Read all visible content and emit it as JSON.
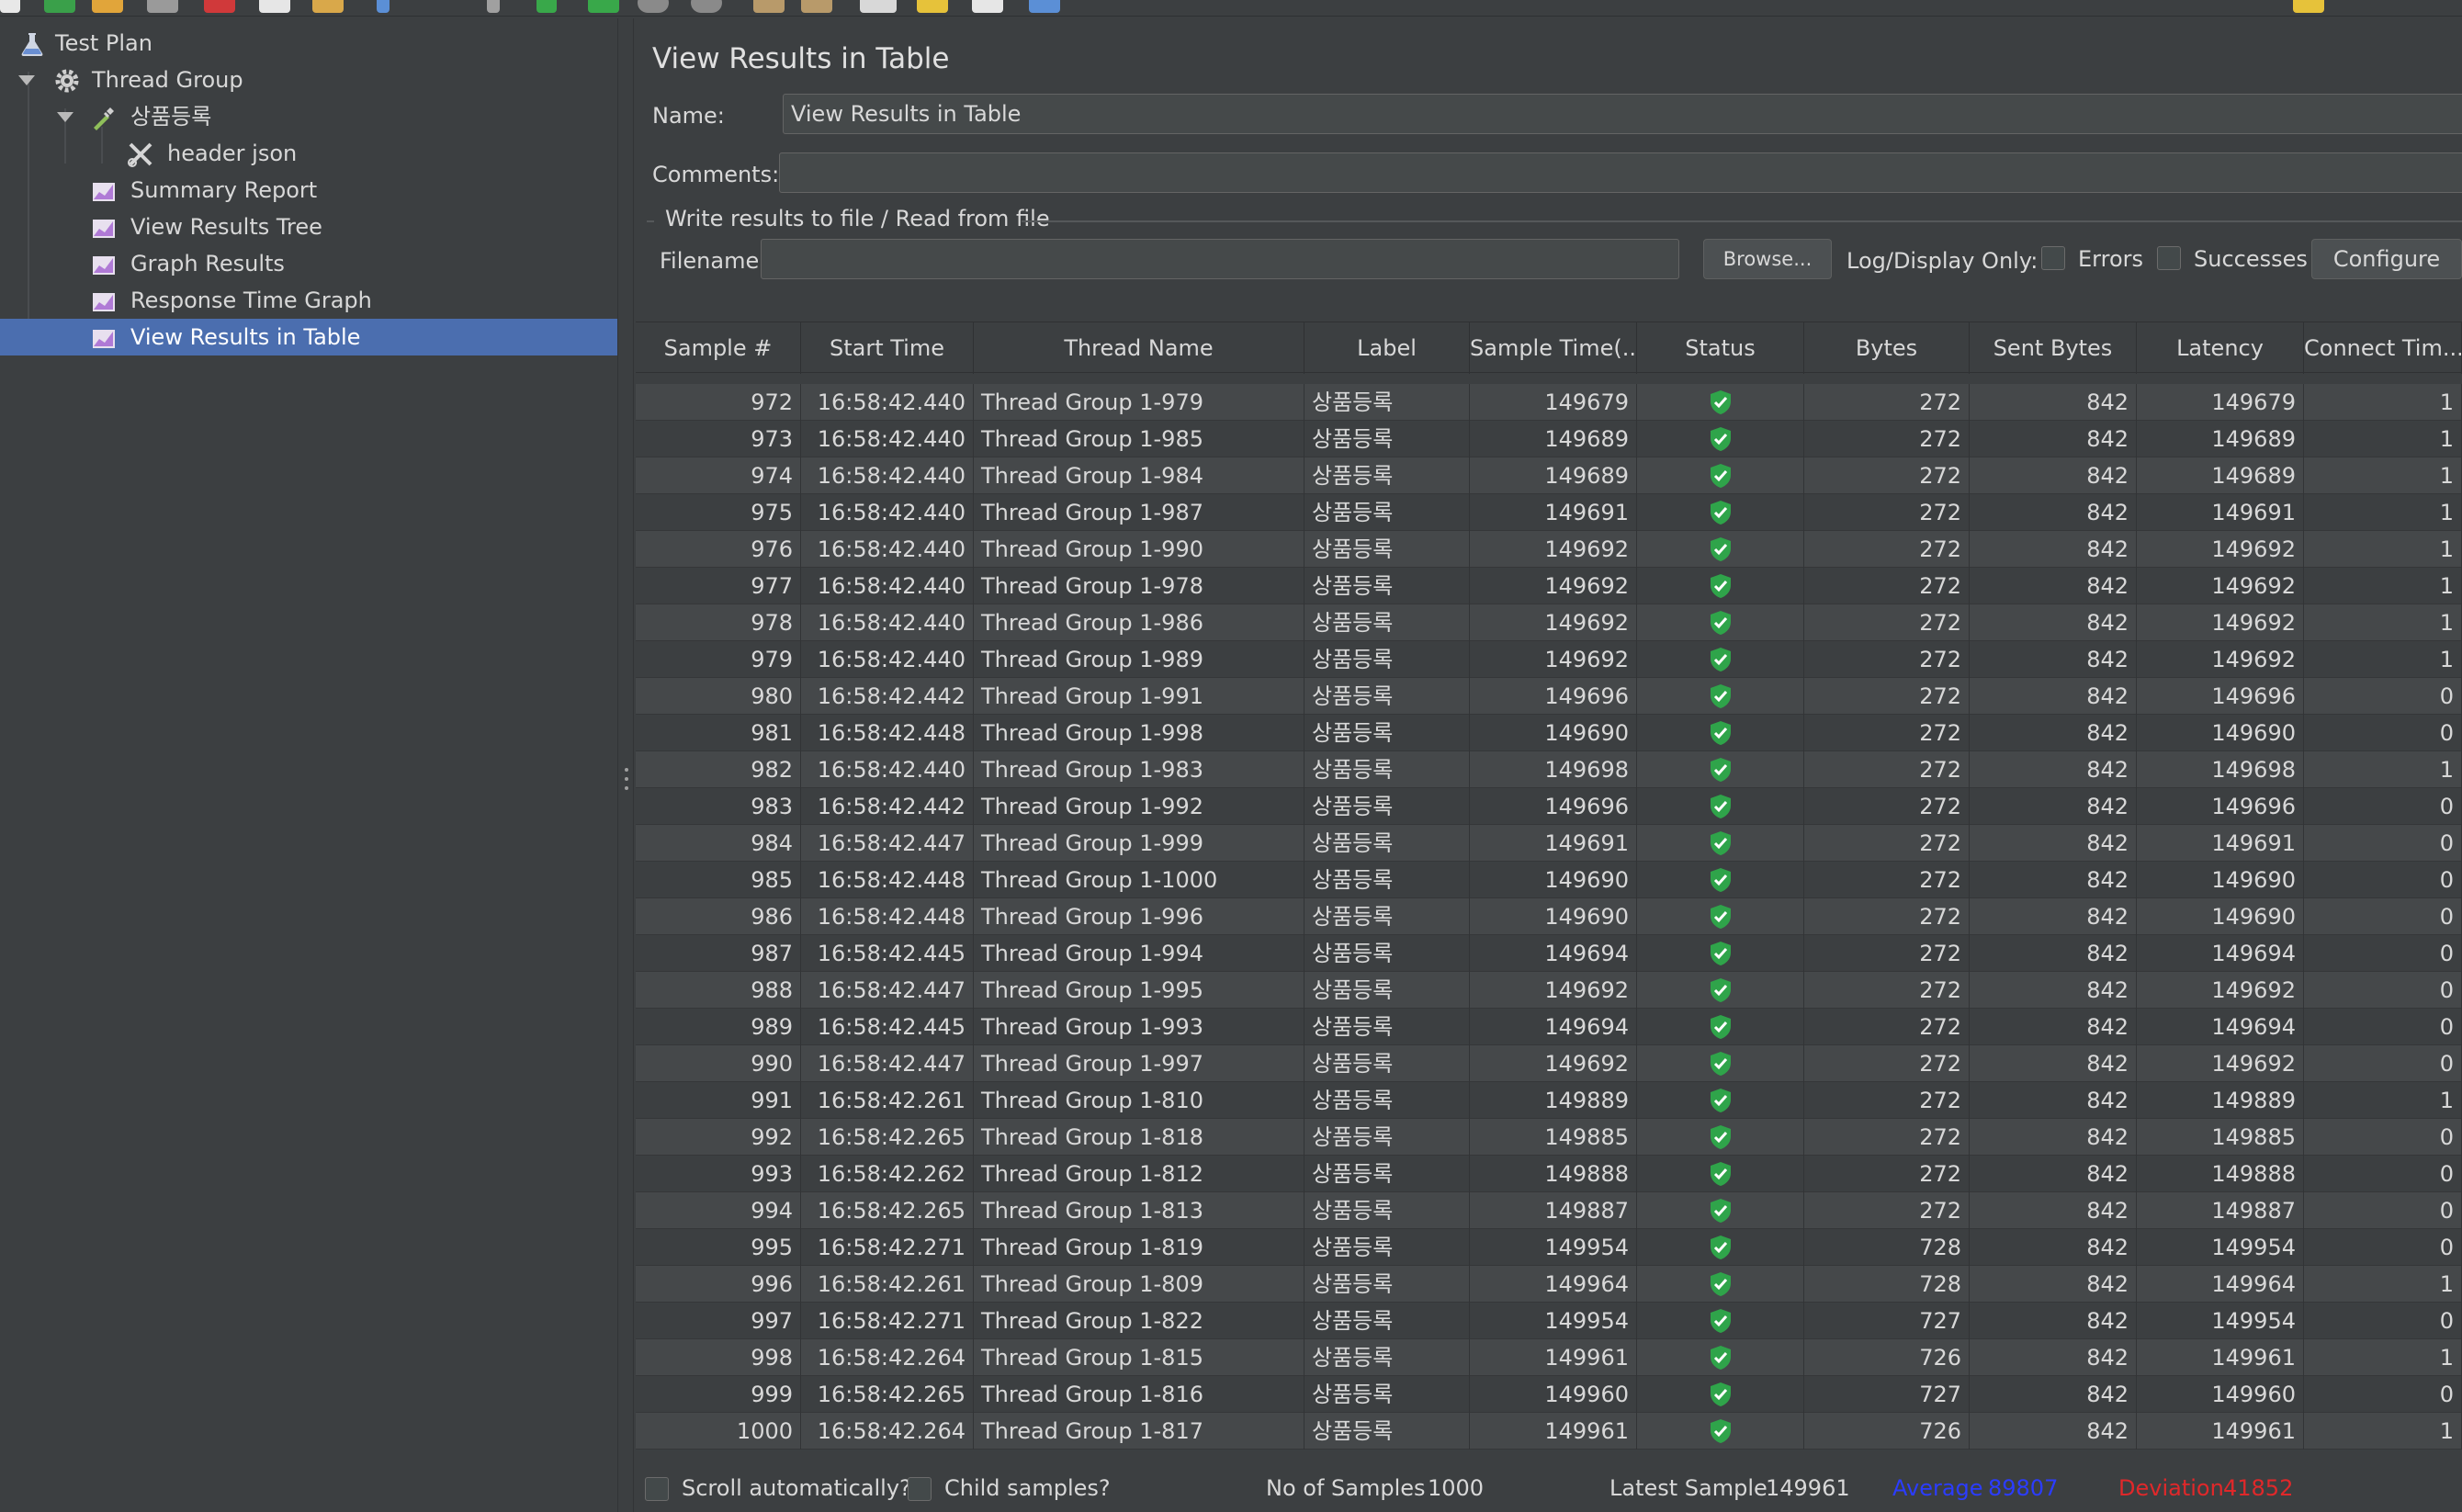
{
  "tree": {
    "items": [
      {
        "label": "Test Plan",
        "icon": "flask-icon"
      },
      {
        "label": "Thread Group",
        "icon": "gear-icon"
      },
      {
        "label": "상품등록",
        "icon": "pipette-icon"
      },
      {
        "label": "header json",
        "icon": "wrench-scissors-icon"
      },
      {
        "label": "Summary Report",
        "icon": "chart-icon"
      },
      {
        "label": "View Results Tree",
        "icon": "chart-icon"
      },
      {
        "label": "Graph Results",
        "icon": "chart-icon"
      },
      {
        "label": "Response Time Graph",
        "icon": "chart-icon"
      },
      {
        "label": "View Results in Table",
        "icon": "chart-icon"
      }
    ]
  },
  "panel": {
    "title": "View Results in Table",
    "name_label": "Name:",
    "name_value": "View Results in Table",
    "comments_label": "Comments:",
    "comments_value": "",
    "group_title": "Write results to file / Read from file",
    "filename_label": "Filename",
    "filename_value": "",
    "browse_label": "Browse...",
    "log_display_label": "Log/Display Only:",
    "errors_label": "Errors",
    "successes_label": "Successes",
    "configure_label": "Configure"
  },
  "table": {
    "columns": [
      "Sample #",
      "Start Time",
      "Thread Name",
      "Label",
      "Sample Time(...",
      "Status",
      "Bytes",
      "Sent Bytes",
      "Latency",
      "Connect Tim..."
    ],
    "rows": [
      [
        "972",
        "16:58:42.440",
        "Thread Group 1-979",
        "상품등록",
        "149679",
        "success",
        "272",
        "842",
        "149679",
        "1"
      ],
      [
        "973",
        "16:58:42.440",
        "Thread Group 1-985",
        "상품등록",
        "149689",
        "success",
        "272",
        "842",
        "149689",
        "1"
      ],
      [
        "974",
        "16:58:42.440",
        "Thread Group 1-984",
        "상품등록",
        "149689",
        "success",
        "272",
        "842",
        "149689",
        "1"
      ],
      [
        "975",
        "16:58:42.440",
        "Thread Group 1-987",
        "상품등록",
        "149691",
        "success",
        "272",
        "842",
        "149691",
        "1"
      ],
      [
        "976",
        "16:58:42.440",
        "Thread Group 1-990",
        "상품등록",
        "149692",
        "success",
        "272",
        "842",
        "149692",
        "1"
      ],
      [
        "977",
        "16:58:42.440",
        "Thread Group 1-978",
        "상품등록",
        "149692",
        "success",
        "272",
        "842",
        "149692",
        "1"
      ],
      [
        "978",
        "16:58:42.440",
        "Thread Group 1-986",
        "상품등록",
        "149692",
        "success",
        "272",
        "842",
        "149692",
        "1"
      ],
      [
        "979",
        "16:58:42.440",
        "Thread Group 1-989",
        "상품등록",
        "149692",
        "success",
        "272",
        "842",
        "149692",
        "1"
      ],
      [
        "980",
        "16:58:42.442",
        "Thread Group 1-991",
        "상품등록",
        "149696",
        "success",
        "272",
        "842",
        "149696",
        "0"
      ],
      [
        "981",
        "16:58:42.448",
        "Thread Group 1-998",
        "상품등록",
        "149690",
        "success",
        "272",
        "842",
        "149690",
        "0"
      ],
      [
        "982",
        "16:58:42.440",
        "Thread Group 1-983",
        "상품등록",
        "149698",
        "success",
        "272",
        "842",
        "149698",
        "1"
      ],
      [
        "983",
        "16:58:42.442",
        "Thread Group 1-992",
        "상품등록",
        "149696",
        "success",
        "272",
        "842",
        "149696",
        "0"
      ],
      [
        "984",
        "16:58:42.447",
        "Thread Group 1-999",
        "상품등록",
        "149691",
        "success",
        "272",
        "842",
        "149691",
        "0"
      ],
      [
        "985",
        "16:58:42.448",
        "Thread Group 1-1000",
        "상품등록",
        "149690",
        "success",
        "272",
        "842",
        "149690",
        "0"
      ],
      [
        "986",
        "16:58:42.448",
        "Thread Group 1-996",
        "상품등록",
        "149690",
        "success",
        "272",
        "842",
        "149690",
        "0"
      ],
      [
        "987",
        "16:58:42.445",
        "Thread Group 1-994",
        "상품등록",
        "149694",
        "success",
        "272",
        "842",
        "149694",
        "0"
      ],
      [
        "988",
        "16:58:42.447",
        "Thread Group 1-995",
        "상품등록",
        "149692",
        "success",
        "272",
        "842",
        "149692",
        "0"
      ],
      [
        "989",
        "16:58:42.445",
        "Thread Group 1-993",
        "상품등록",
        "149694",
        "success",
        "272",
        "842",
        "149694",
        "0"
      ],
      [
        "990",
        "16:58:42.447",
        "Thread Group 1-997",
        "상품등록",
        "149692",
        "success",
        "272",
        "842",
        "149692",
        "0"
      ],
      [
        "991",
        "16:58:42.261",
        "Thread Group 1-810",
        "상품등록",
        "149889",
        "success",
        "272",
        "842",
        "149889",
        "1"
      ],
      [
        "992",
        "16:58:42.265",
        "Thread Group 1-818",
        "상품등록",
        "149885",
        "success",
        "272",
        "842",
        "149885",
        "0"
      ],
      [
        "993",
        "16:58:42.262",
        "Thread Group 1-812",
        "상품등록",
        "149888",
        "success",
        "272",
        "842",
        "149888",
        "0"
      ],
      [
        "994",
        "16:58:42.265",
        "Thread Group 1-813",
        "상품등록",
        "149887",
        "success",
        "272",
        "842",
        "149887",
        "0"
      ],
      [
        "995",
        "16:58:42.271",
        "Thread Group 1-819",
        "상품등록",
        "149954",
        "success",
        "728",
        "842",
        "149954",
        "0"
      ],
      [
        "996",
        "16:58:42.261",
        "Thread Group 1-809",
        "상품등록",
        "149964",
        "success",
        "728",
        "842",
        "149964",
        "1"
      ],
      [
        "997",
        "16:58:42.271",
        "Thread Group 1-822",
        "상품등록",
        "149954",
        "success",
        "727",
        "842",
        "149954",
        "0"
      ],
      [
        "998",
        "16:58:42.264",
        "Thread Group 1-815",
        "상품등록",
        "149961",
        "success",
        "726",
        "842",
        "149961",
        "1"
      ],
      [
        "999",
        "16:58:42.265",
        "Thread Group 1-816",
        "상품등록",
        "149960",
        "success",
        "727",
        "842",
        "149960",
        "0"
      ],
      [
        "1000",
        "16:58:42.264",
        "Thread Group 1-817",
        "상품등록",
        "149961",
        "success",
        "726",
        "842",
        "149961",
        "1"
      ]
    ]
  },
  "footer": {
    "scroll_label": "Scroll automatically?",
    "child_label": "Child samples?",
    "samples_label": "No of Samples",
    "samples_value": "1000",
    "latest_label": "Latest Sample",
    "latest_value": "149961",
    "average_label": "Average",
    "average_value": "89807",
    "deviation_label": "Deviation",
    "deviation_value": "41852"
  },
  "colors": {
    "selection": "#4b6eaf",
    "average": "#2b3cff",
    "deviation": "#e0282a",
    "status_ok": "#2fa44a"
  }
}
